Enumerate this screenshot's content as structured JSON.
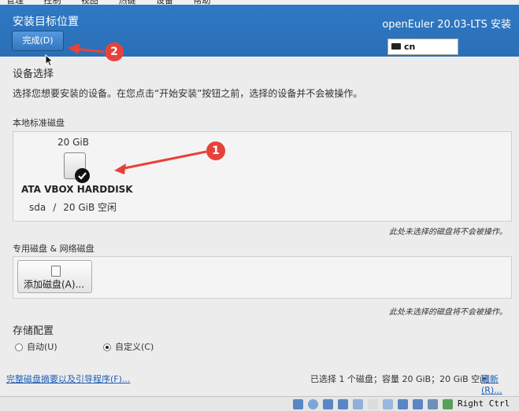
{
  "vm_menubar": [
    "管理",
    "控制",
    "视图",
    "热键",
    "设备",
    "帮助"
  ],
  "header": {
    "title": "安装目标位置",
    "done_label": "完成(D)",
    "brand": "openEuler 20.03-LTS 安装",
    "keyboard_layout": "cn"
  },
  "device_selection": {
    "title": "设备选择",
    "description": "选择您想要安装的设备。在您点击“开始安装”按钮之前，选择的设备并不会被操作。"
  },
  "local_disks": {
    "label": "本地标准磁盘",
    "disks": [
      {
        "size": "20 GiB",
        "name": "ATA VBOX HARDDISK",
        "device": "sda",
        "separator": "/",
        "free": "20 GiB 空闲",
        "selected": true
      }
    ],
    "note": "此处未选择的磁盘将不会被操作。"
  },
  "network_disks": {
    "label": "专用磁盘 & 网络磁盘",
    "add_label": "添加磁盘(A)...",
    "note": "此处未选择的磁盘将不会被操作。"
  },
  "storage_config": {
    "title": "存储配置",
    "options": [
      {
        "label": "自动(U)",
        "selected": false
      },
      {
        "label": "自定义(C)",
        "selected": true
      }
    ]
  },
  "footer": {
    "summary_link": "完整磁盘摘要以及引导程序(F)...",
    "status": "已选择 1 个磁盘；容量 20 GiB；20 GiB 空闲",
    "refresh": "刷新(R)..."
  },
  "annotations": {
    "badge1": "1",
    "badge2": "2"
  },
  "vm_statusbar": {
    "host_key": "Right Ctrl"
  },
  "colors": {
    "header": "#2f78c4",
    "annotation": "#e7423a",
    "link": "#1f5fb5"
  }
}
